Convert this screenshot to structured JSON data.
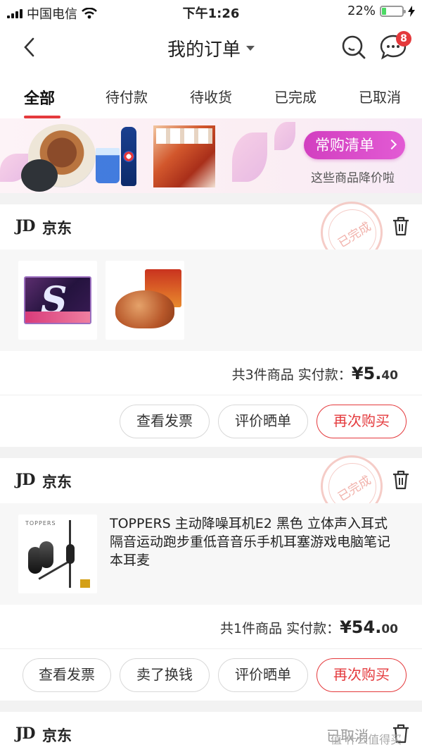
{
  "status_bar": {
    "carrier": "中国电信",
    "time": "下午1:26",
    "battery": "22%",
    "battery_level": 0.22
  },
  "nav": {
    "title": "我的订单",
    "message_badge": "8",
    "icons": [
      "back-icon",
      "search-icon",
      "message-icon"
    ]
  },
  "tabs": [
    {
      "label": "全部",
      "active": true
    },
    {
      "label": "待付款",
      "active": false
    },
    {
      "label": "待收货",
      "active": false
    },
    {
      "label": "已完成",
      "active": false
    },
    {
      "label": "已取消",
      "active": false
    }
  ],
  "banner": {
    "button_label": "常购清单",
    "subtitle": "这些商品降价啦"
  },
  "orders": [
    {
      "shop_logo": "JD",
      "shop": "京东",
      "status": "已完成",
      "summary_prefix": "共3件商品  实付款：",
      "price_yuan": "¥5.",
      "price_cents": "40",
      "buttons": [
        "查看发票",
        "评价晒单",
        "再次购买"
      ]
    },
    {
      "shop_logo": "JD",
      "shop": "京东",
      "status": "已完成",
      "product_title": "TOPPERS 主动降噪耳机E2 黑色 立体声入耳式隔音运动跑步重低音音乐手机耳塞游戏电脑笔记本耳麦",
      "thumb_brand": "TOPPERS",
      "summary_prefix": "共1件商品  实付款：",
      "price_yuan": "¥54.",
      "price_cents": "00",
      "buttons": [
        "查看发票",
        "卖了换钱",
        "评价晒单",
        "再次购买"
      ]
    },
    {
      "shop_logo": "JD",
      "shop": "京东",
      "status": "已取消"
    }
  ],
  "watermark": "值 什么值得买"
}
